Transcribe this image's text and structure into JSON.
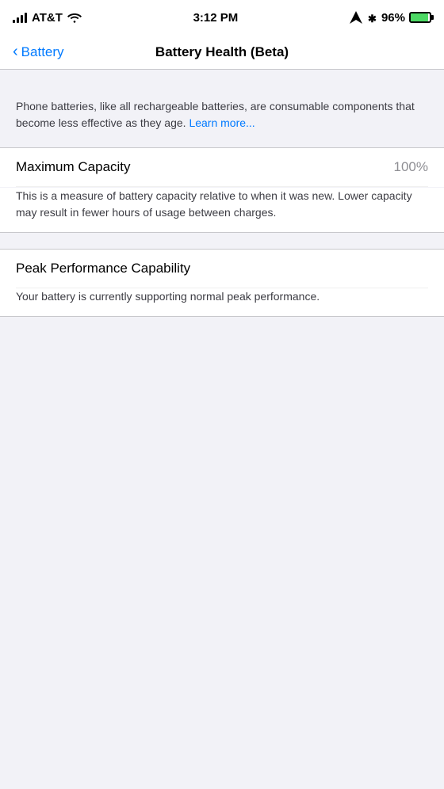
{
  "statusBar": {
    "carrier": "AT&T",
    "time": "3:12 PM",
    "batteryPercent": "96%"
  },
  "navBar": {
    "backLabel": "Battery",
    "title": "Battery Health (Beta)"
  },
  "infoSection": {
    "text": "Phone batteries, like all rechargeable batteries, are consumable components that become less effective as they age.",
    "learnMoreLabel": "Learn more..."
  },
  "maximumCapacity": {
    "label": "Maximum Capacity",
    "value": "100%",
    "description": "This is a measure of battery capacity relative to when it was new. Lower capacity may result in fewer hours of usage between charges."
  },
  "peakPerformance": {
    "label": "Peak Performance Capability",
    "description": "Your battery is currently supporting normal peak performance."
  }
}
